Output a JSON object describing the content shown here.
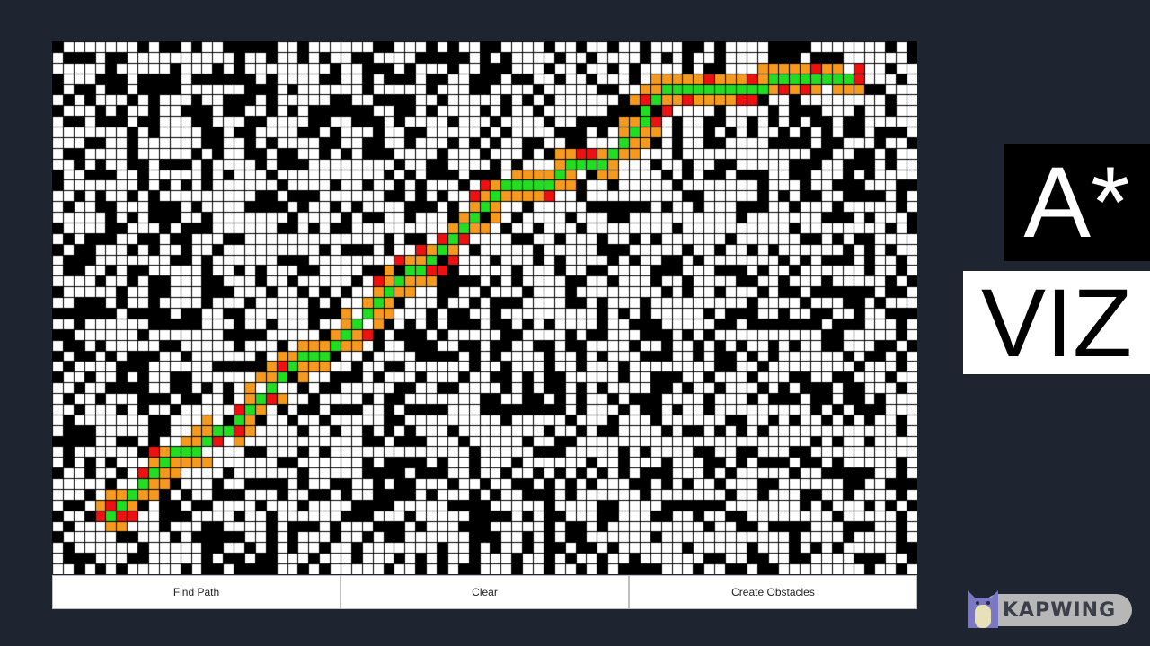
{
  "grid": {
    "cols": 81,
    "rows": 50,
    "obstacle_density": 0.36,
    "colors": {
      "empty": "#ffffff",
      "wall": "#000000",
      "gridline": "#000000",
      "path": "#22dd22",
      "open_set": "#f59a1e",
      "closed_set": "#ee1111"
    },
    "path_waypoints": [
      [
        5,
        44
      ],
      [
        8,
        41
      ],
      [
        13,
        38
      ],
      [
        16,
        36
      ],
      [
        25,
        29
      ],
      [
        34,
        21
      ],
      [
        46,
        13
      ],
      [
        51,
        11
      ],
      [
        55,
        6
      ],
      [
        66,
        4
      ],
      [
        74,
        3
      ]
    ]
  },
  "controls": {
    "find_path_label": "Find Path",
    "clear_label": "Clear",
    "create_obstacles_label": "Create Obstacles"
  },
  "title": {
    "line1": "A*",
    "line2": "VIZ"
  },
  "watermark": {
    "text": "KAPWING",
    "icon": "kapwing-cat-icon"
  }
}
